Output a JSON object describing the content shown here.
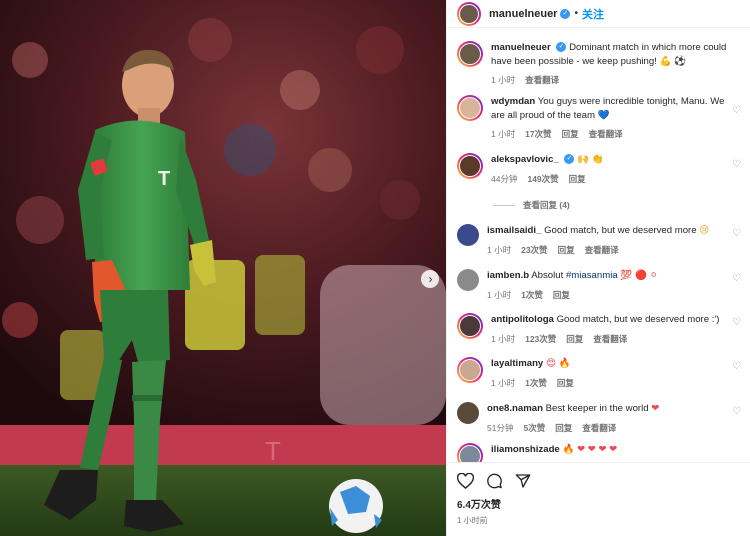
{
  "post": {
    "author": "manuelneuer",
    "follow_label": "关注",
    "separator": "•"
  },
  "caption": {
    "username": "manuelneuer",
    "text": "Dominant match in which more could have been possible - we keep pushing!",
    "emoji": "💪 ⚽",
    "time": "1 小时",
    "translate": "查看翻译"
  },
  "comments": [
    {
      "username": "wdymdan",
      "text": "You guys were incredible tonight, Manu. We are all proud of the team",
      "emoji": "💙",
      "time": "1 小时",
      "likes": "17次赞",
      "reply": "回复",
      "translate": "查看翻译"
    },
    {
      "username": "alekspavlovic_",
      "text": "",
      "emoji": "🙌 👏",
      "time": "44分钟",
      "likes": "149次赞",
      "reply": "回复",
      "translate": ""
    },
    {
      "username": "ismailsaidi_",
      "text": "Good match, but we deserved more",
      "emoji": "😢",
      "time": "1 小时",
      "likes": "23次赞",
      "reply": "回复",
      "translate": "查看翻译"
    },
    {
      "username": "iamben.b",
      "text": "Absolut",
      "hashtag": "#miasanmia",
      "emoji": "💯 🔴 ⚪",
      "time": "1 小时",
      "likes": "1次赞",
      "reply": "回复",
      "translate": ""
    },
    {
      "username": "antipolitologa",
      "text": "Good match, but we deserved more :')",
      "emoji": "",
      "time": "1 小时",
      "likes": "123次赞",
      "reply": "回复",
      "translate": "查看翻译"
    },
    {
      "username": "layaltimany",
      "text": "",
      "emoji": "😍 🔥",
      "time": "1 小时",
      "likes": "1次赞",
      "reply": "回复",
      "translate": ""
    },
    {
      "username": "one8.naman",
      "text": "Best keeper in the world",
      "emoji": "❤",
      "time": "51分钟",
      "likes": "5次赞",
      "reply": "回复",
      "translate": "查看翻译"
    },
    {
      "username": "iliamonshizade",
      "text": "",
      "emoji": "🔥 ❤ ❤ ❤ ❤",
      "time": "",
      "likes": "",
      "reply": "",
      "translate": ""
    }
  ],
  "view_replies": "查看回复 (4)",
  "footer": {
    "likes": "6.4万次赞",
    "time_ago": "1 小时前"
  },
  "colors": {
    "accent": "#0095f6",
    "verified": "#3897f0",
    "jersey": "#3d9a4a",
    "glove": "#e2572c"
  },
  "icons": [
    "verified-icon",
    "heart-icon",
    "comment-icon",
    "share-icon",
    "next-arrow-icon"
  ]
}
